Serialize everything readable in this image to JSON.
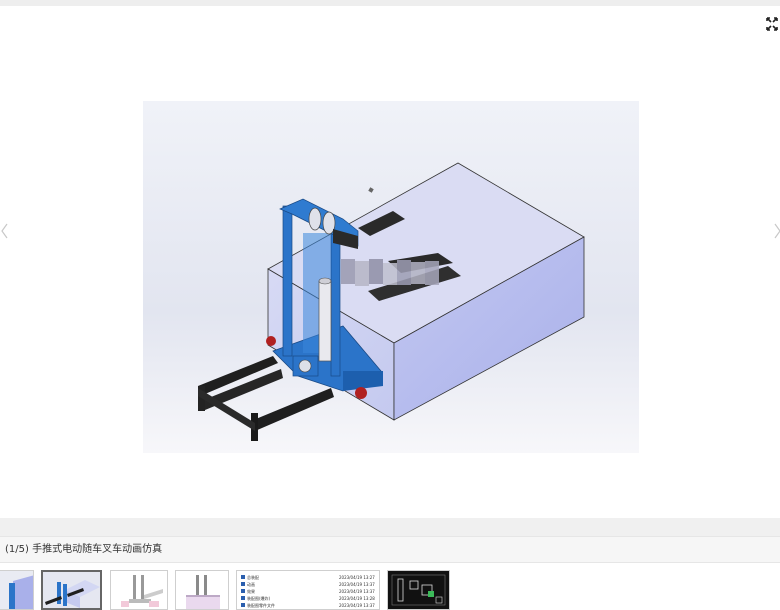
{
  "viewer": {
    "fullscreen_icon": "fullscreen-icon",
    "prev_icon": "chevron-left-icon",
    "next_icon": "chevron-right-icon"
  },
  "main_image": {
    "subject": "hand-push electric stacker forklift CAD model",
    "colors": {
      "frame": "#2b74c9",
      "forks": "#2a2a2a",
      "box": "#c9cdf2",
      "background": "#e3e6f1"
    }
  },
  "caption": {
    "text": "(1/5) 手推式电动随车叉车动画仿真"
  },
  "thumbnails": [
    {
      "label": "",
      "content": "partial-blue"
    },
    {
      "label": "",
      "content": "stacker-color",
      "active": true
    },
    {
      "label": "",
      "content": "stacker-white"
    },
    {
      "label": "",
      "content": "stacker-box"
    },
    {
      "label": "",
      "content": "file-list",
      "files": [
        {
          "name": "总装配",
          "date": "2023/04/19 13:27"
        },
        {
          "name": "动画",
          "date": "2023/04/19 13:37"
        },
        {
          "name": "效果",
          "date": "2023/04/19 13:37"
        },
        {
          "name": "装配图(爆炸)",
          "date": "2023/04/19 13:28"
        },
        {
          "name": "装配图零件文件",
          "date": "2023/04/19 13:37"
        }
      ]
    },
    {
      "label": "",
      "content": "drawing-dark"
    }
  ]
}
